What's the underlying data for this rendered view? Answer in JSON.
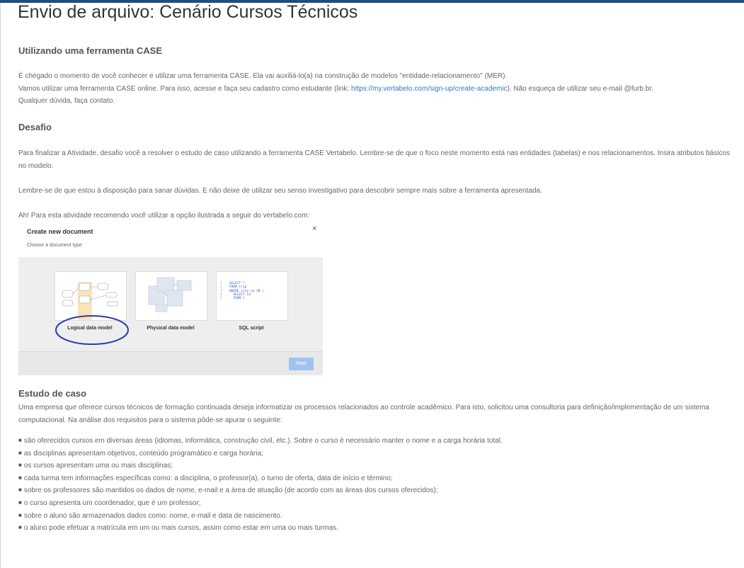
{
  "page_title": "Envio de arquivo: Cenário Cursos Técnicos",
  "section1": {
    "heading": "Utilizando uma ferramenta CASE",
    "para1": "É chegado o momento de você conhecer e utilizar uma ferramenta CASE. Ela vai auxiliá-lo(a) na construção de modelos \"entidade-relacionamento\" (MER).",
    "para2_before": "Vamos utilizar uma ferramenta CASE online. Para isso, acesse e faça seu cadastro como estudante (link: ",
    "para2_link": "https://my.vertabelo.com/sign-up/create-academic",
    "para2_after": "). Não esqueça de utilizar seu e-mail @furb.br.",
    "para3": "Qualquer dúvida, faça contato."
  },
  "section2": {
    "heading": "Desafio",
    "para1": "Para finalizar a Atividade, desafio você a resolver o estudo de caso utilizando a ferramenta CASE Vertabelo. Lembre-se de que o foco neste momento está nas entidades (tabelas) e nos relacionamentos. Insira atributos básicos no modelo.",
    "para2": "Lembre-se de que estou à disposição para sanar dúvidas. E não deixe de utilizar seu senso investigativo para descobrir sempre mais sobre a ferramenta apresentada.",
    "para3": "Ah! Para esta atividade recomendo você utilizar a opção ilustrada a seguir do vertabelo.com:"
  },
  "dialog": {
    "title": "Create new document",
    "subtitle": "Choose a document type",
    "close": "×",
    "options": [
      "Logical data model",
      "Physical data model",
      "SQL script"
    ],
    "sql_lines": [
      "1",
      "2",
      "3",
      "4",
      "5"
    ],
    "sql_code": [
      "SELECT *",
      "FROM trip",
      "WHERE city_id IN (",
      "  SELECT id",
      "  FROM (",
      ""
    ],
    "next_label": "Next"
  },
  "section3": {
    "heading": "Estudo de caso",
    "para1": "Uma empresa que oferece cursos técnicos de formação continuada deseja informatizar os processos relacionados ao controle acadêmico. Para isto, solicitou  uma consultoria para definição/implementação de um sistema computacional. Na análise dos requisitos para o sistema pôde-se apurar o seguinte:",
    "bullet_marker": "■",
    "bullets": [
      "são oferecidos cursos em diversas áreas (idiomas, informática, construção civil, etc.). Sobre o curso é necessário manter o nome e a carga horária total.",
      "as disciplinas apresentam objetivos, conteúdo programático e carga horária;",
      "os cursos apresentam uma ou mais disciplinas;",
      "cada turma tem informações específicas como: a disciplina, o professor(a), o turno de oferta, data de início e término;",
      "sobre os professores são mantidos os dados de nome, e-mail e a área de atuação (de acordo com as áreas dos cursos oferecidos);",
      "o curso apresenta um coordenador, que é um professor;",
      "sobre o aluno são armazenados dados como: nome, e-mail e data de nascimento.",
      "o aluno pode efetuar a matrícula em um ou mais cursos, assim como estar em uma ou mais turmas."
    ]
  },
  "colors": {
    "top_bar": "#1f4e79",
    "link": "#2e7bbf",
    "highlight_circle": "#2b3bb0",
    "next_button": "#9fc3ef"
  }
}
